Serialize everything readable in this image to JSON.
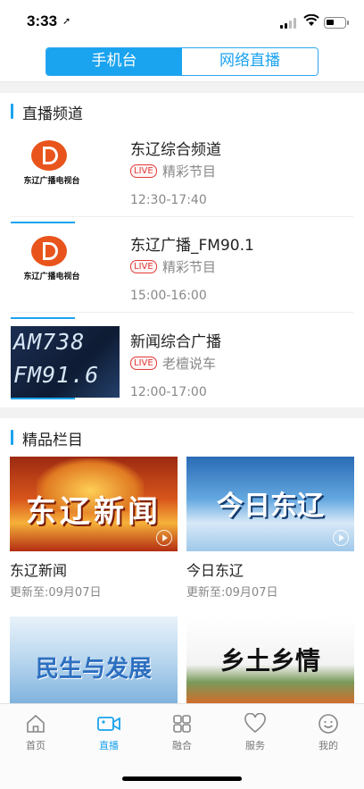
{
  "status": {
    "time": "3:33",
    "location_glyph": "➚"
  },
  "segment": {
    "tab1": "手机台",
    "tab2": "网络直播",
    "active": "tab1"
  },
  "live_section": {
    "title": "直播频道",
    "logo_text": "东辽广播电视台",
    "channels": [
      {
        "name": "东辽综合频道",
        "badge": "LIVE",
        "program": "精彩节目",
        "time": "12:30-17:40"
      },
      {
        "name": "东辽广播_FM90.1",
        "badge": "LIVE",
        "program": "精彩节目",
        "time": "15:00-16:00"
      },
      {
        "name": "新闻综合广播",
        "badge": "LIVE",
        "program": "老檀说车",
        "time": "12:00-17:00",
        "thumb_line1": "AM738",
        "thumb_line2": "FM91.6"
      }
    ]
  },
  "featured_section": {
    "title": "精品栏目",
    "cards": [
      {
        "title": "东辽新闻",
        "updated": "更新至:09月07日",
        "art": "东辽新闻"
      },
      {
        "title": "今日东辽",
        "updated": "更新至:09月07日",
        "art": "今日东辽"
      },
      {
        "title": "",
        "updated": "",
        "art": "民生与发展"
      },
      {
        "title": "",
        "updated": "",
        "art": "乡土乡情"
      }
    ]
  },
  "tabbar": {
    "items": [
      {
        "label": "首页",
        "icon": "home-icon"
      },
      {
        "label": "直播",
        "icon": "video-camera-icon"
      },
      {
        "label": "融合",
        "icon": "grid-icon"
      },
      {
        "label": "服务",
        "icon": "heart-icon"
      },
      {
        "label": "我的",
        "icon": "smiley-icon"
      }
    ],
    "active": 1
  },
  "colors": {
    "accent": "#1aa3ef",
    "live": "#e23b3b",
    "logo": "#e8541c"
  }
}
